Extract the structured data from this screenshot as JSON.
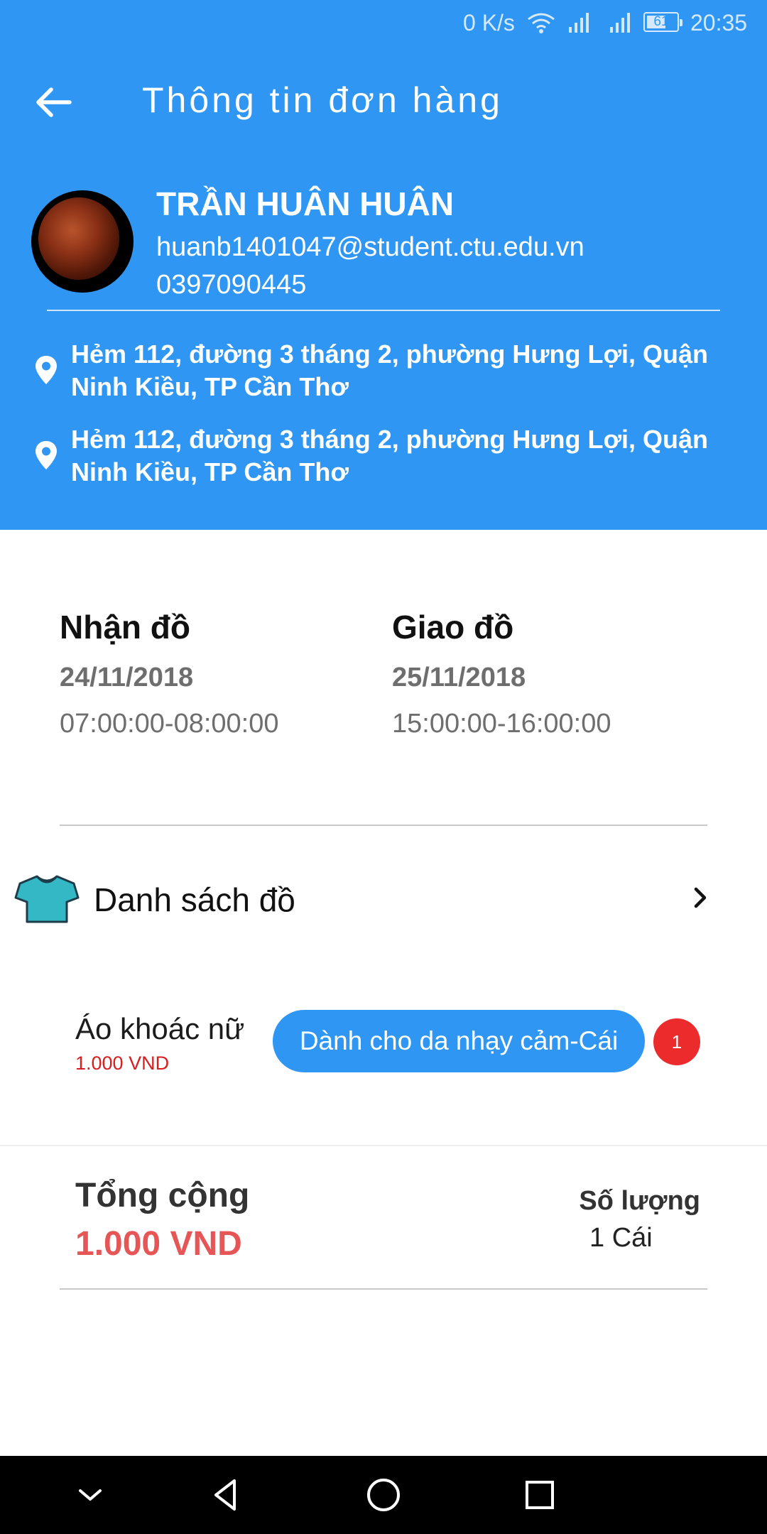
{
  "status_bar": {
    "network_speed": "0 K/s",
    "battery": "61",
    "time": "20:35"
  },
  "header": {
    "title": "Thông tin đơn hàng",
    "back_icon": "arrow-left-icon"
  },
  "customer": {
    "name": "TRẦN HUÂN HUÂN",
    "email": "huanb1401047@student.ctu.edu.vn",
    "phone": "0397090445",
    "addresses": [
      "Hẻm 112, đường 3 tháng 2, phường Hưng Lợi, Quận Ninh Kiều, TP Cần Thơ",
      "Hẻm 112, đường 3 tháng 2, phường Hưng Lợi, Quận Ninh Kiều, TP Cần Thơ"
    ]
  },
  "schedule": {
    "pickup": {
      "label": "Nhận đồ",
      "date": "24/11/2018",
      "time": "07:00:00-08:00:00"
    },
    "delivery": {
      "label": "Giao đồ",
      "date": "25/11/2018",
      "time": "15:00:00-16:00:00"
    }
  },
  "items_section": {
    "title": "Danh sách đồ",
    "icon": "shirt-icon",
    "items": [
      {
        "name": "Áo khoác nữ",
        "price": "1.000 VND",
        "option": "Dành cho da nhạy cảm-Cái",
        "quantity": "1"
      }
    ]
  },
  "summary": {
    "total_label": "Tổng cộng",
    "total_value": "1.000 VND",
    "quantity_label": "Số lượng",
    "quantity_value": "1 Cái"
  },
  "colors": {
    "primary": "#2f97f3",
    "price_red": "#d81e1e",
    "total_red": "#e65656",
    "badge_red": "#ec2c2c"
  }
}
